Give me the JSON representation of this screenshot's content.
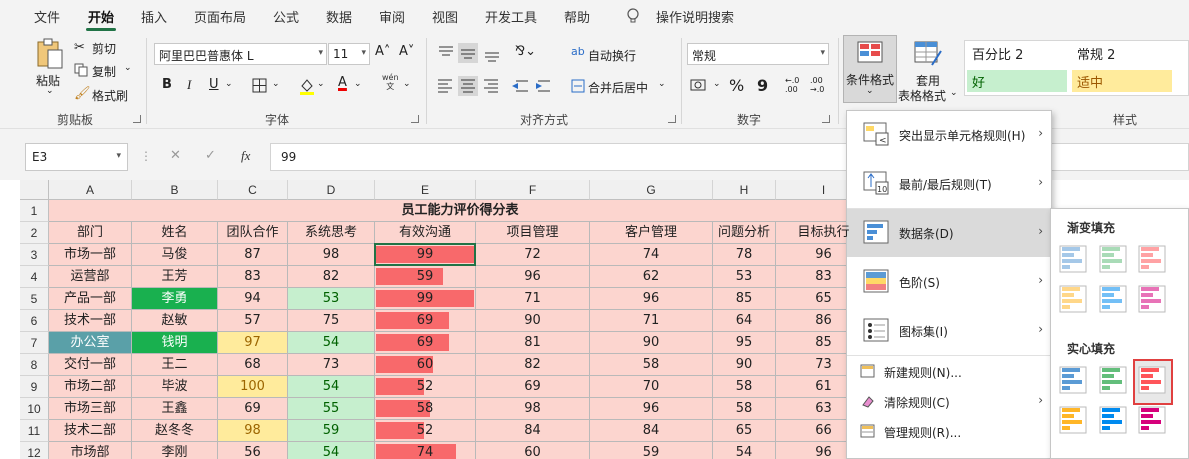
{
  "tabs": [
    "文件",
    "开始",
    "插入",
    "页面布局",
    "公式",
    "数据",
    "审阅",
    "视图",
    "开发工具",
    "帮助",
    "操作说明搜索"
  ],
  "active_tab": "开始",
  "clipboard": {
    "paste": "粘贴",
    "cut": "剪切",
    "copy": "复制",
    "format_painter": "格式刷",
    "group": "剪贴板"
  },
  "font": {
    "name": "阿里巴巴普惠体 L",
    "size": "11",
    "grow": "A˄",
    "shrink": "A˅",
    "bold": "B",
    "italic": "I",
    "underline": "U",
    "group": "字体",
    "wen": "wén\n文"
  },
  "alignment": {
    "wrap": "自动换行",
    "merge": "合并后居中",
    "group": "对齐方式"
  },
  "number": {
    "format": "常规",
    "percent": "%",
    "comma": "9",
    "inc_decimal": "←.0\n.00",
    "dec_decimal": ".00\n→.0",
    "group": "数字"
  },
  "styles": {
    "conditional_format": "条件格式",
    "table_format_1": "套用",
    "table_format_2": "表格格式",
    "cell1": "百分比 2",
    "cell2": "常规 2",
    "good": "好",
    "neutral": "适中",
    "group": "样式"
  },
  "formula_bar": {
    "name_box": "E3",
    "cancel": "✕",
    "confirm": "✓",
    "fx": "fx",
    "value": "99"
  },
  "columns": [
    "A",
    "B",
    "C",
    "D",
    "E",
    "F",
    "G",
    "H",
    "I"
  ],
  "rows": [
    "1",
    "2",
    "3",
    "4",
    "5",
    "6",
    "7",
    "8",
    "9",
    "10",
    "11",
    "12"
  ],
  "sheet": {
    "title": "员工能力评价得分表",
    "headers": [
      "部门",
      "姓名",
      "团队合作",
      "系统思考",
      "有效沟通",
      "项目管理",
      "客户管理",
      "问题分析",
      "目标执行"
    ],
    "data": [
      [
        "市场一部",
        "马俊",
        "87",
        "98",
        "99",
        "72",
        "74",
        "78",
        "96"
      ],
      [
        "运营部",
        "王芳",
        "83",
        "82",
        "59",
        "96",
        "62",
        "53",
        "83"
      ],
      [
        "产品一部",
        "李勇",
        "94",
        "53",
        "99",
        "71",
        "96",
        "85",
        "65"
      ],
      [
        "技术一部",
        "赵敏",
        "57",
        "75",
        "69",
        "90",
        "71",
        "64",
        "86"
      ],
      [
        "办公室",
        "钱明",
        "97",
        "54",
        "69",
        "81",
        "90",
        "95",
        "85"
      ],
      [
        "交付一部",
        "王二",
        "68",
        "73",
        "60",
        "82",
        "58",
        "90",
        "73"
      ],
      [
        "市场二部",
        "毕波",
        "100",
        "54",
        "52",
        "69",
        "70",
        "58",
        "61"
      ],
      [
        "市场三部",
        "王鑫",
        "69",
        "55",
        "58",
        "98",
        "96",
        "58",
        "63"
      ],
      [
        "技术二部",
        "赵冬冬",
        "98",
        "59",
        "52",
        "84",
        "84",
        "65",
        "66"
      ],
      [
        "市场部",
        "李刚",
        "56",
        "54",
        "74",
        "60",
        "59",
        "54",
        "96"
      ]
    ],
    "e_bar_fraction": [
      1.0,
      0.68,
      1.0,
      0.74,
      0.74,
      0.58,
      0.49,
      0.55,
      0.49,
      0.82
    ],
    "colors": {
      "base": "#fcd5cf",
      "green_fill": "#19b04f",
      "teal_fill": "#5aa0a8",
      "yellow_fill": "#ffeb9c",
      "lightgreen_fill": "#c6efce",
      "bar": "#f8696b"
    }
  },
  "cf_menu": {
    "items": [
      "突出显示单元格规则(H)",
      "最前/最后规则(T)",
      "数据条(D)",
      "色阶(S)",
      "图标集(I)"
    ],
    "items2": [
      "新建规则(N)...",
      "清除规则(C)",
      "管理规则(R)..."
    ],
    "arrow": "›"
  },
  "databar_submenu": {
    "gradient": "渐变填充",
    "solid": "实心填充",
    "colors": [
      "#5b9bd5",
      "#63be7b",
      "#ff555a",
      "#ffb628",
      "#008aef",
      "#d6007b"
    ]
  }
}
